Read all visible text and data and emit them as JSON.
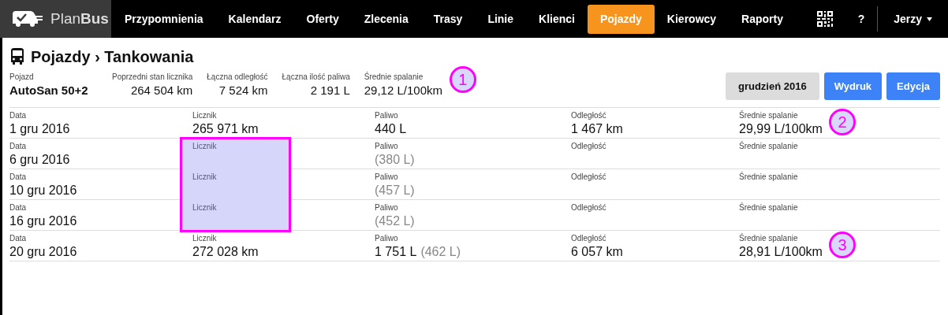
{
  "brand": {
    "light": "Plan",
    "bold": "Bus"
  },
  "nav": [
    {
      "label": "Przypomnienia",
      "selected": false
    },
    {
      "label": "Kalendarz",
      "selected": false
    },
    {
      "label": "Oferty",
      "selected": false
    },
    {
      "label": "Zlecenia",
      "selected": false
    },
    {
      "label": "Trasy",
      "selected": false
    },
    {
      "label": "Linie",
      "selected": false
    },
    {
      "label": "Klienci",
      "selected": false
    },
    {
      "label": "Pojazdy",
      "selected": true
    },
    {
      "label": "Kierowcy",
      "selected": false
    },
    {
      "label": "Raporty",
      "selected": false
    }
  ],
  "help": "?",
  "user": "Jerzy",
  "title": {
    "section": "Pojazdy",
    "separator": "›",
    "page": "Tankowania"
  },
  "summary": [
    {
      "label": "Pojazd",
      "value": "AutoSan 50+2"
    },
    {
      "label": "Poprzedni stan licznika",
      "value": "264 504 km"
    },
    {
      "label": "Łączna odległość",
      "value": "7 524 km"
    },
    {
      "label": "Łączna ilość paliwa",
      "value": "2 191 L"
    },
    {
      "label": "Średnie spalanie",
      "value": "29,12 L/100km",
      "callout": "1"
    }
  ],
  "buttons": [
    {
      "label": "grudzień 2016",
      "kind": "secondary"
    },
    {
      "label": "Wydruk",
      "kind": "primary"
    },
    {
      "label": "Edycja",
      "kind": "primary"
    }
  ],
  "rows": [
    {
      "cells": [
        {
          "label": "Data",
          "value": "1 gru 2016"
        },
        {
          "label": "Licznik",
          "value": "265 971 km"
        },
        {
          "label": "Paliwo",
          "value": "440 L"
        },
        {
          "label": "Odległość",
          "value": "1 467 km"
        },
        {
          "label": "Średnie spalanie",
          "value": "29,99 L/100km",
          "callout": "2"
        }
      ]
    },
    {
      "cells": [
        {
          "label": "Data",
          "value": "6 gru 2016"
        },
        {
          "label": "Licznik",
          "highlighted": true
        },
        {
          "label": "Paliwo",
          "note": "(380 L)"
        },
        {
          "label": "Odległość"
        },
        {
          "label": "Średnie spalanie"
        }
      ]
    },
    {
      "cells": [
        {
          "label": "Data",
          "value": "10 gru 2016"
        },
        {
          "label": "Licznik",
          "highlighted": true
        },
        {
          "label": "Paliwo",
          "note": "(457 L)"
        },
        {
          "label": "Odległość"
        },
        {
          "label": "Średnie spalanie"
        }
      ]
    },
    {
      "cells": [
        {
          "label": "Data",
          "value": "16 gru 2016"
        },
        {
          "label": "Licznik",
          "highlighted": true
        },
        {
          "label": "Paliwo",
          "note": "(452 L)"
        },
        {
          "label": "Odległość"
        },
        {
          "label": "Średnie spalanie"
        }
      ]
    },
    {
      "cells": [
        {
          "label": "Data",
          "value": "20 gru 2016"
        },
        {
          "label": "Licznik",
          "value": "272 028 km"
        },
        {
          "label": "Paliwo",
          "value": "1 751 L",
          "note": "(462 L)"
        },
        {
          "label": "Odległość",
          "value": "6 057 km"
        },
        {
          "label": "Średnie spalanie",
          "value": "28,91 L/100km",
          "callout": "3"
        }
      ]
    }
  ]
}
